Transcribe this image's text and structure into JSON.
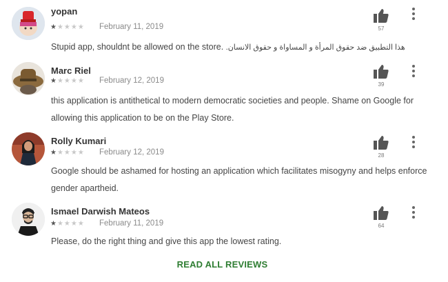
{
  "colors": {
    "action_green": "#2e7d32",
    "star_on": "#555555",
    "star_off": "#c8c8c8"
  },
  "reviews": [
    {
      "name": "yopan",
      "rating": 1,
      "date": "February 11, 2019",
      "text": "Stupid app, shouldnt be allowed on the store.",
      "text_arabic": "هذا التطبيق ضد حقوق المرأة و المساواة و حقوق الانسان.",
      "helpful_count": "57"
    },
    {
      "name": "Marc Riel",
      "rating": 1,
      "date": "February 12, 2019",
      "text": "this application is antithetical to modern democratic societies and people. Shame on Google for allowing this application to be on the Play Store.",
      "helpful_count": "39"
    },
    {
      "name": "Rolly Kumari",
      "rating": 1,
      "date": "February 12, 2019",
      "text": "Google should be ashamed for hosting an application which facilitates misogyny and helps enforce gender apartheid.",
      "helpful_count": "28"
    },
    {
      "name": "Ismael Darwish Mateos",
      "rating": 1,
      "date": "February 11, 2019",
      "text": "Please, do the right thing and give this app the lowest rating.",
      "helpful_count": "64"
    }
  ],
  "read_all_label": "READ ALL REVIEWS"
}
